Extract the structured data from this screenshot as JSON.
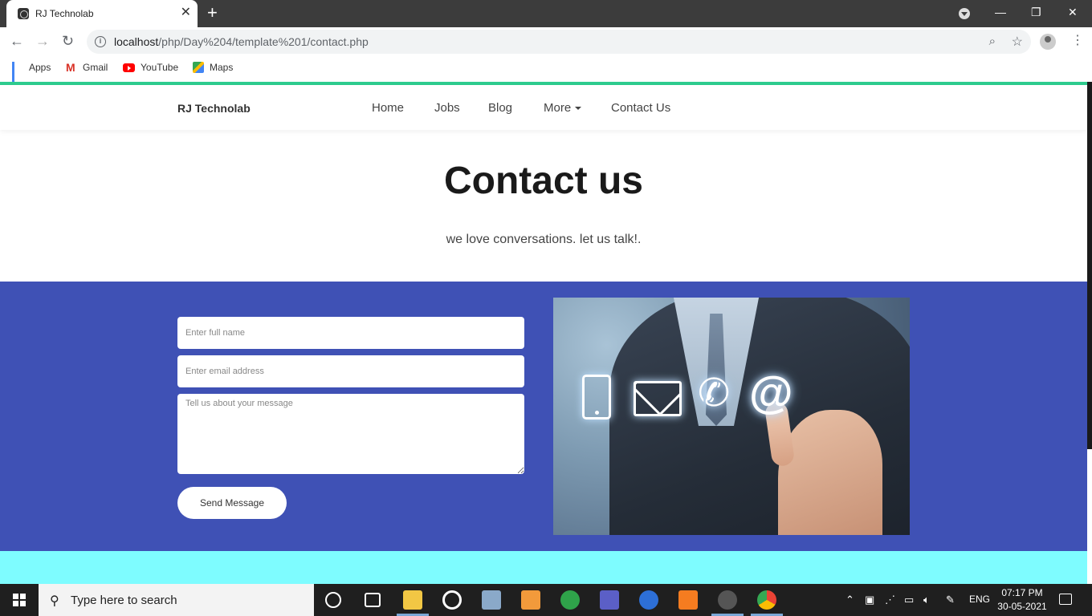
{
  "browser": {
    "tab_title": "RJ Technolab",
    "tab_close": "✕",
    "new_tab": "+",
    "url_host": "localhost",
    "url_path": "/php/Day%204/template%201/contact.php",
    "window_controls": [
      "—",
      "❐",
      "✕"
    ],
    "bookmarks": [
      {
        "label": "Apps",
        "icon": "apps-grid-icon"
      },
      {
        "label": "Gmail",
        "icon": "gmail-icon"
      },
      {
        "label": "YouTube",
        "icon": "youtube-icon"
      },
      {
        "label": "Maps",
        "icon": "maps-icon"
      }
    ]
  },
  "site": {
    "brand": "RJ Technolab",
    "nav": [
      {
        "label": "Home"
      },
      {
        "label": "Jobs"
      },
      {
        "label": "Blog"
      },
      {
        "label": "More"
      },
      {
        "label": "Contact Us"
      }
    ],
    "accent_color": "#2ecc8f",
    "section_color": "#3f51b5",
    "footer_color": "#7efcff"
  },
  "hero": {
    "title": "Contact us",
    "subtitle": "we love conversations. let us talk!."
  },
  "form": {
    "name_placeholder": "Enter full name",
    "email_placeholder": "Enter email address",
    "message_placeholder": "Tell us about your message",
    "submit_label": "Send Message"
  },
  "taskbar": {
    "search_placeholder": "Type here to search",
    "language": "ENG",
    "time": "07:17 PM",
    "date": "30-05-2021"
  }
}
